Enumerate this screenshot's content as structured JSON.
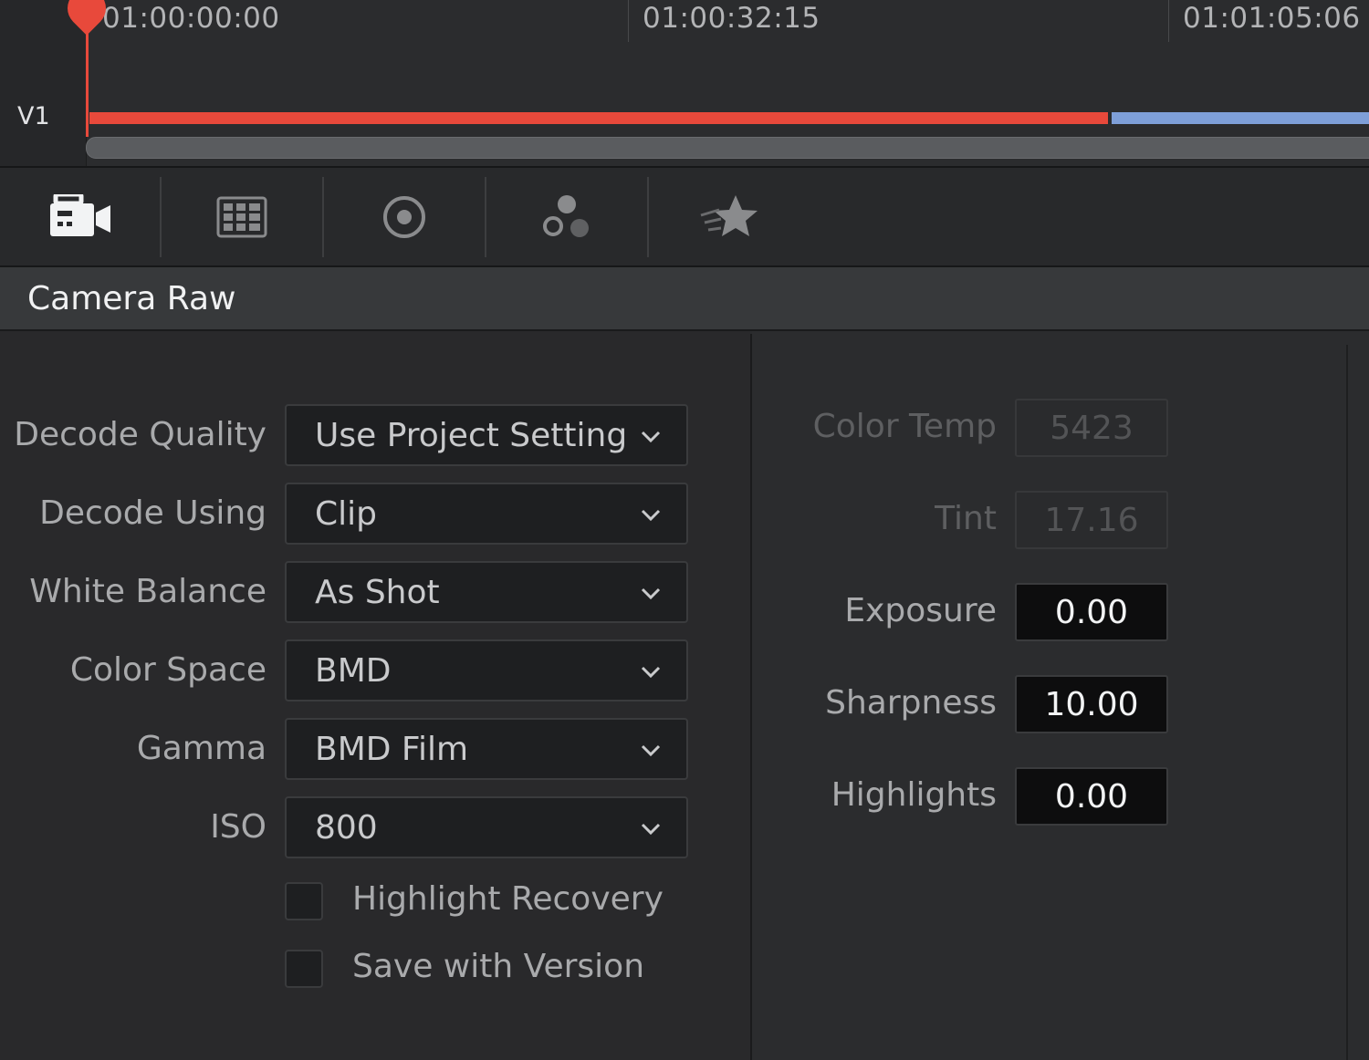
{
  "timeline": {
    "track_name": "V1",
    "timecodes": [
      "01:00:00:00",
      "01:00:32:15",
      "01:01:05:06"
    ]
  },
  "toolbar": {
    "tools": [
      {
        "icon": "camera-raw-icon",
        "active": true
      },
      {
        "icon": "color-chart-icon",
        "active": false
      },
      {
        "icon": "target-icon",
        "active": false
      },
      {
        "icon": "node-circles-icon",
        "active": false
      },
      {
        "icon": "favorite-star-icon",
        "active": false
      }
    ]
  },
  "section": {
    "title": "Camera Raw"
  },
  "left_panel": {
    "rows": [
      {
        "label": "Decode Quality",
        "value": "Use Project Setting"
      },
      {
        "label": "Decode Using",
        "value": "Clip"
      },
      {
        "label": "White Balance",
        "value": "As Shot"
      },
      {
        "label": "Color Space",
        "value": "BMD"
      },
      {
        "label": "Gamma",
        "value": "BMD Film"
      },
      {
        "label": "ISO",
        "value": "800"
      }
    ],
    "checkboxes": [
      {
        "label": "Highlight Recovery",
        "checked": false
      },
      {
        "label": "Save with Version",
        "checked": false
      }
    ]
  },
  "right_panel": {
    "fields": [
      {
        "label": "Color Temp",
        "value": "5423",
        "enabled": false
      },
      {
        "label": "Tint",
        "value": "17.16",
        "enabled": false
      },
      {
        "label": "Exposure",
        "value": "0.00",
        "enabled": true
      },
      {
        "label": "Sharpness",
        "value": "10.00",
        "enabled": true
      },
      {
        "label": "Highlights",
        "value": "0.00",
        "enabled": true
      }
    ]
  },
  "colors": {
    "playhead": "#e8493b",
    "clip_red": "#e8493b",
    "clip_blue": "#7e9fd8",
    "background": "#2a2b2d"
  }
}
